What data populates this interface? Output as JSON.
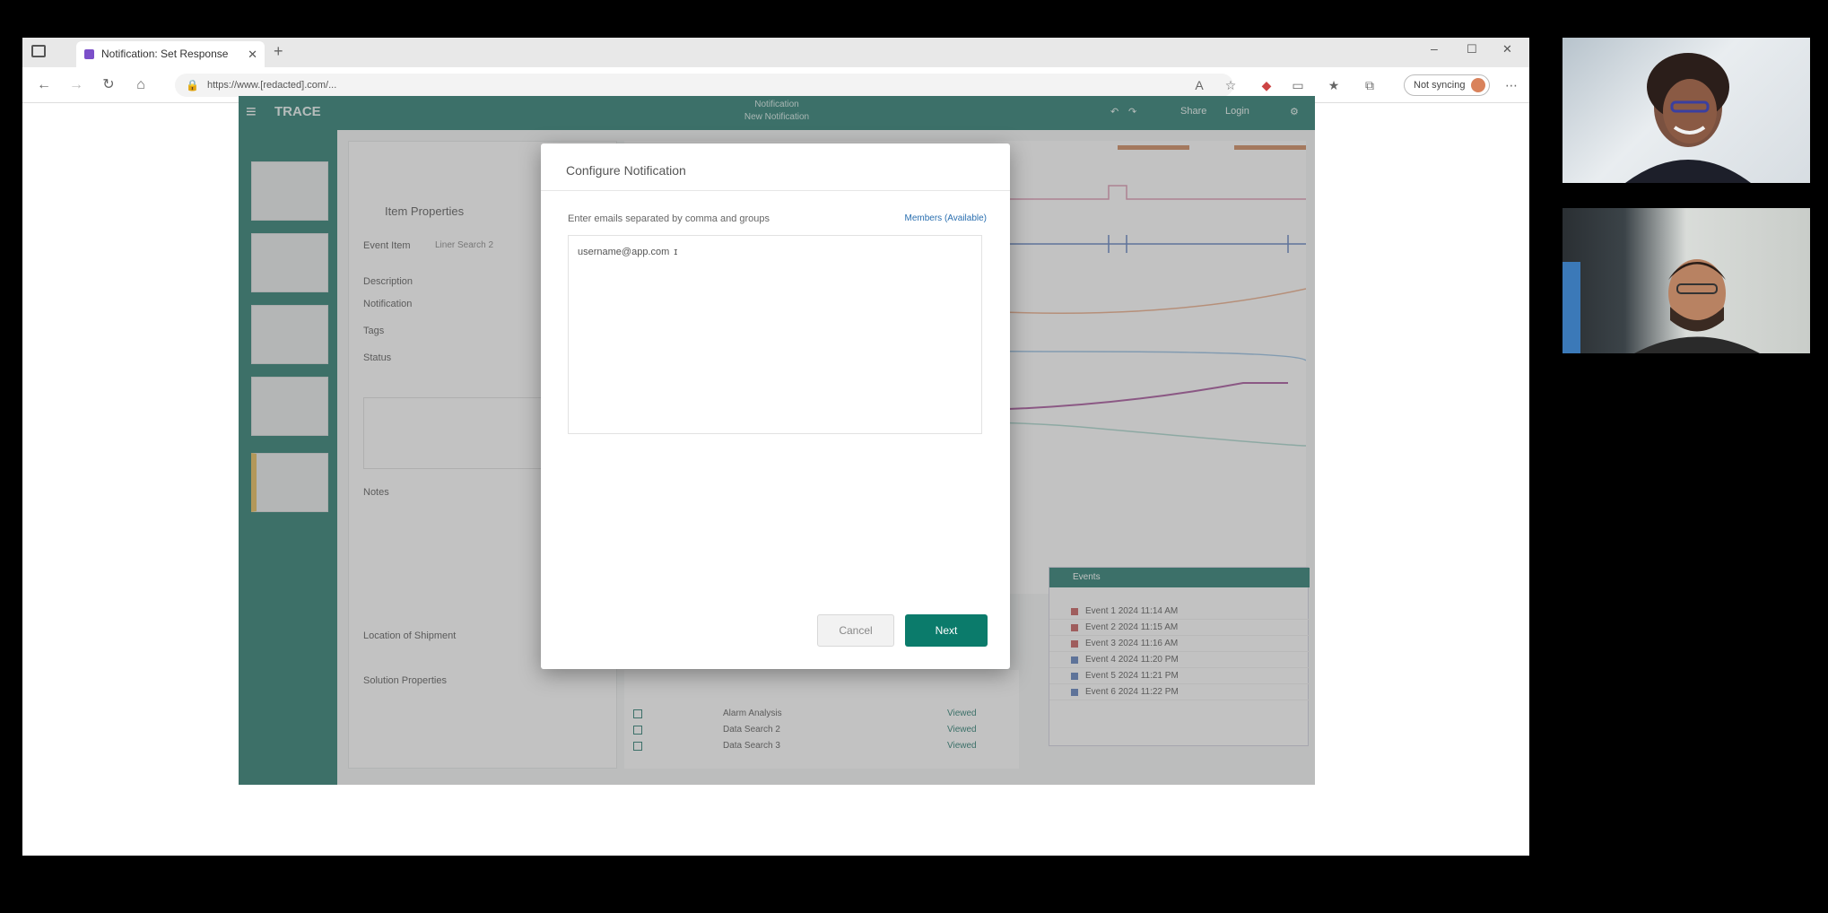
{
  "browser": {
    "tab_title": "Notification: Set Response",
    "url": "https://www.[redacted].com/...",
    "profile_label": "Not syncing"
  },
  "app": {
    "brand": "TRACE",
    "canvas_title": "Notification",
    "canvas_subtitle": "New Notification",
    "header_actions": [
      "Share",
      "Login"
    ],
    "properties": {
      "title": "Item Properties",
      "event_label": "Event Item",
      "event_value": "Liner Search 2",
      "description_label": "Description",
      "notification_label": "Notification",
      "tags_label": "Tags",
      "status_label": "Status",
      "notes_label": "Notes",
      "location_label": "Location of Shipment",
      "solution_label": "Solution Properties"
    },
    "events_panel": {
      "title": "Events",
      "rows": [
        "Event 1 2024 11:14 AM",
        "Event 2 2024 11:15 AM",
        "Event 3 2024 11:16 AM",
        "Event 4 2024 11:20 PM",
        "Event 5 2024 11:21 PM",
        "Event 6 2024 11:22 PM"
      ]
    },
    "signal_list": [
      {
        "name": "Alarm Analysis",
        "status": "Viewed"
      },
      {
        "name": "Data Search 2",
        "status": "Viewed"
      },
      {
        "name": "Data Search 3",
        "status": "Viewed"
      }
    ]
  },
  "modal": {
    "title": "Configure Notification",
    "recipients_label": "Enter emails separated by comma and groups",
    "recipients_link": "Members (Available)",
    "recipients_value": "username@app.com",
    "cancel_label": "Cancel",
    "next_label": "Next"
  },
  "colors": {
    "brand": "#0b6b5d",
    "primary_button": "#0b7b6b",
    "selected_thumb": "#e3b341"
  }
}
